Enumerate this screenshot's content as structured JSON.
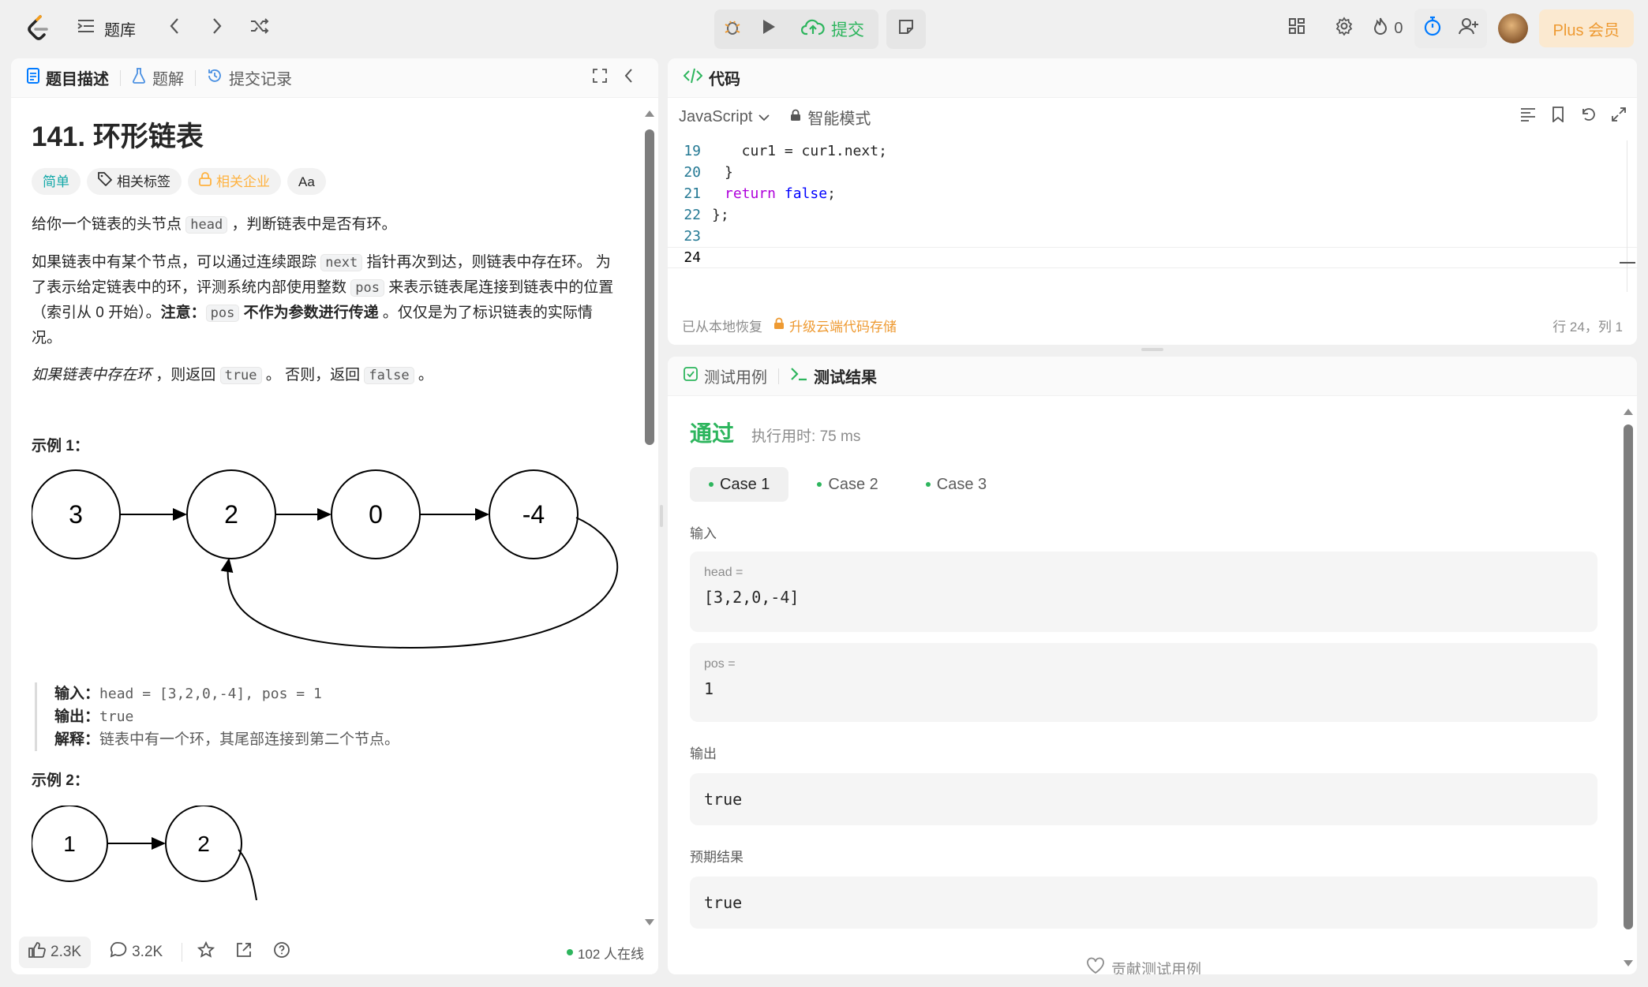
{
  "nav": {
    "problem_list_label": "题库",
    "submit_label": "提交",
    "streak_count": "0",
    "plus_label": "Plus 会员"
  },
  "desc_panel": {
    "tabs": [
      "题目描述",
      "题解",
      "提交记录"
    ],
    "title": "141. 环形链表",
    "difficulty": "简单",
    "tag_topics": "相关标签",
    "tag_companies": "相关企业",
    "tag_translate": "Aa",
    "p1_a": "给你一个链表的头节点 ",
    "p1_code": "head",
    "p1_b": " ，判断链表中是否有环。",
    "p2_a": "如果链表中有某个节点，可以通过连续跟踪 ",
    "p2_code1": "next",
    "p2_b": " 指针再次到达，则链表中存在环。 为了表示给定链表中的环，评测系统内部使用整数 ",
    "p2_code2": "pos",
    "p2_c": " 来表示链表尾连接到链表中的位置（索引从 0 开始）。",
    "p2_note": "注意：",
    "p2_code3": "pos",
    "p2_bold": " 不作为参数进行传递",
    "p2_d": " 。仅仅是为了标识链表的实际情况。",
    "p3_em": "如果链表中存在环",
    "p3_a": " ，则返回 ",
    "p3_code1": "true",
    "p3_b": " 。 否则，返回 ",
    "p3_code2": "false",
    "p3_c": " 。",
    "example1_title": "示例 1：",
    "example1_nodes": [
      "3",
      "2",
      "0",
      "-4"
    ],
    "example1_input_label": "输入：",
    "example1_input": "head = [3,2,0,-4], pos = 1",
    "example1_output_label": "输出：",
    "example1_output": "true",
    "example1_explain_label": "解释：",
    "example1_explain": "链表中有一个环，其尾部连接到第二个节点。",
    "example2_title": "示例 2：",
    "example2_nodes": [
      "1",
      "2"
    ],
    "likes": "2.3K",
    "comments": "3.2K",
    "online": "102 人在线"
  },
  "code_panel": {
    "title": "代码",
    "language": "JavaScript",
    "mode": "智能模式",
    "lines": [
      {
        "n": "19",
        "text": "    cur1 = cur1.next;"
      },
      {
        "n": "20",
        "text": "  }"
      },
      {
        "n": "21",
        "text": "  return false;"
      },
      {
        "n": "22",
        "text": "};"
      },
      {
        "n": "23",
        "text": ""
      },
      {
        "n": "24",
        "text": ""
      }
    ],
    "restored": "已从本地恢复",
    "upgrade": "升级云端代码存储",
    "cursor": "行 24，列 1"
  },
  "result_panel": {
    "tab_testcase": "测试用例",
    "tab_result": "测试结果",
    "status": "通过",
    "runtime": "执行用时: 75 ms",
    "cases": [
      "Case 1",
      "Case 2",
      "Case 3"
    ],
    "input_label": "输入",
    "param1_name": "head =",
    "param1_value": "[3,2,0,-4]",
    "param2_name": "pos =",
    "param2_value": "1",
    "output_label": "输出",
    "output_value": "true",
    "expected_label": "预期结果",
    "expected_value": "true",
    "contribute": "贡献测试用例"
  },
  "colors": {
    "accent_green": "#2db55d",
    "easy_teal": "#13a8a8",
    "premium_orange": "#ffb23f",
    "timer_blue": "#007aff"
  }
}
